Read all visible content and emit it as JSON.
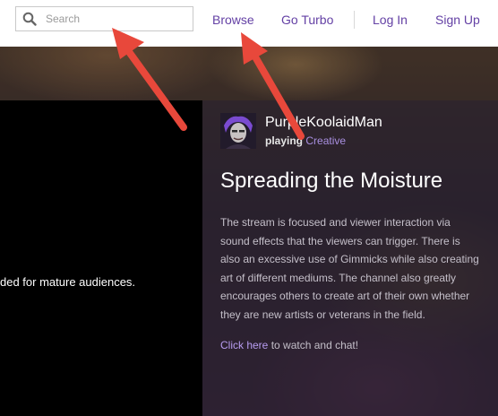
{
  "search": {
    "placeholder": "Search"
  },
  "nav": {
    "browse": "Browse",
    "go_turbo": "Go Turbo",
    "log_in": "Log In",
    "sign_up": "Sign Up"
  },
  "video": {
    "message": "ded for mature audiences."
  },
  "channel": {
    "name": "PurpleKoolaidMan",
    "playing_label": "playing",
    "game": "Creative"
  },
  "stream": {
    "title": "Spreading the Moisture",
    "description": "The stream is focused and viewer interaction via sound effects that the viewers can trigger. There is also an excessive use of Gimmicks while also creating art of different mediums. The channel also greatly encourages others to create art of their own whether they are new artists or veterans in the field.",
    "cta_link": "Click here",
    "cta_text": " to watch and chat!"
  },
  "colors": {
    "brand_purple": "#6441a5",
    "link_purple": "#b79cf0",
    "annotation_red": "#e8483b"
  },
  "icons": {
    "search": "magnifier-icon",
    "annotation": "red-arrow-icon"
  }
}
